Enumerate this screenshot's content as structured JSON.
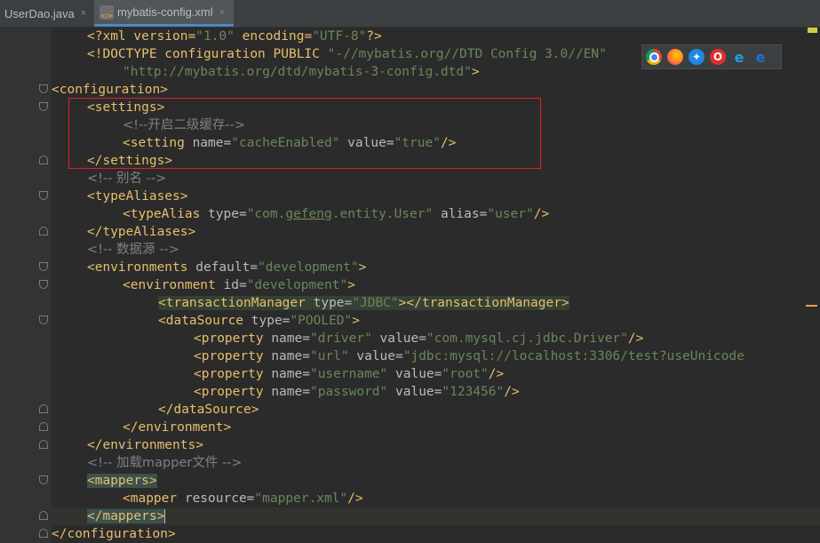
{
  "tabs": [
    {
      "label": "UserDao.java",
      "close": "×"
    },
    {
      "label": "mybatis-config.xml",
      "close": "×",
      "icon": "xml-file-icon"
    }
  ],
  "browser_icons": [
    "chrome-icon",
    "firefox-icon",
    "safari-icon",
    "opera-icon",
    "ie-icon",
    "edge-icon"
  ],
  "code": {
    "l1": {
      "t1": "<?xml version=",
      "s1": "\"1.0\"",
      "t2": " encoding=",
      "s2": "\"UTF-8\"",
      "t3": "?>"
    },
    "l2": {
      "t1": "<!DOCTYPE configuration PUBLIC ",
      "s1": "\"-//mybatis.org//DTD Config 3.0//EN\""
    },
    "l3": {
      "s1": "\"http://mybatis.org/dtd/mybatis-3-config.dtd\"",
      "t1": ">"
    },
    "l4": {
      "t1": "<configuration>"
    },
    "l5": {
      "t1": "<settings>"
    },
    "l6": {
      "c1": "<!--开启二级缓存-->"
    },
    "l7": {
      "t1": "<setting ",
      "a1": "name=",
      "s1": "\"cacheEnabled\"",
      "a2": " value=",
      "s2": "\"true\"",
      "t2": "/>"
    },
    "l8": {
      "t1": "</settings>"
    },
    "l9": {
      "c1": "<!-- 别名 -->"
    },
    "l10": {
      "t1": "<typeAliases>"
    },
    "l11": {
      "t1": "<typeAlias ",
      "a1": "type=",
      "s1a": "\"com.",
      "s1b": "gefeng",
      "s1c": ".entity.User\"",
      "a2": " alias=",
      "s2": "\"user\"",
      "t2": "/>"
    },
    "l12": {
      "t1": "</typeAliases>"
    },
    "l13": {
      "c1": "<!-- 数据源 -->"
    },
    "l14": {
      "t1": "<environments ",
      "a1": "default=",
      "s1": "\"development\"",
      "t2": ">"
    },
    "l15": {
      "t1": "<environment ",
      "a1": "id=",
      "s1": "\"development\"",
      "t2": ">"
    },
    "l16": {
      "t1": "<transactionManager ",
      "a1": "type=",
      "s1": "\"JDBC\"",
      "t2": "></transactionManager>"
    },
    "l17": {
      "t1": "<dataSource ",
      "a1": "type=",
      "s1": "\"POOLED\"",
      "t2": ">"
    },
    "l18": {
      "t1": "<property ",
      "a1": "name=",
      "s1": "\"driver\"",
      "a2": " value=",
      "s2": "\"com.mysql.cj.jdbc.Driver\"",
      "t2": "/>"
    },
    "l19": {
      "t1": "<property ",
      "a1": "name=",
      "s1": "\"url\"",
      "a2": " value=",
      "s2": "\"jdbc:mysql://localhost:3306/test?useUnicode"
    },
    "l20": {
      "t1": "<property ",
      "a1": "name=",
      "s1": "\"username\"",
      "a2": " value=",
      "s2": "\"root\"",
      "t2": "/>"
    },
    "l21": {
      "t1": "<property ",
      "a1": "name=",
      "s1": "\"password\"",
      "a2": " value=",
      "s2": "\"123456\"",
      "t2": "/>"
    },
    "l22": {
      "t1": "</dataSource>"
    },
    "l23": {
      "t1": "</environment>"
    },
    "l24": {
      "t1": "</environments>"
    },
    "l25": {
      "c1": "<!-- 加载mapper文件 -->"
    },
    "l26": {
      "t1": "<mappers>"
    },
    "l27": {
      "t1": "<mapper ",
      "a1": "resource=",
      "s1": "\"mapper.xml\"",
      "t2": "/>"
    },
    "l28": {
      "t1": "</mappers>"
    },
    "l29": {
      "t1": "</configuration>"
    }
  }
}
